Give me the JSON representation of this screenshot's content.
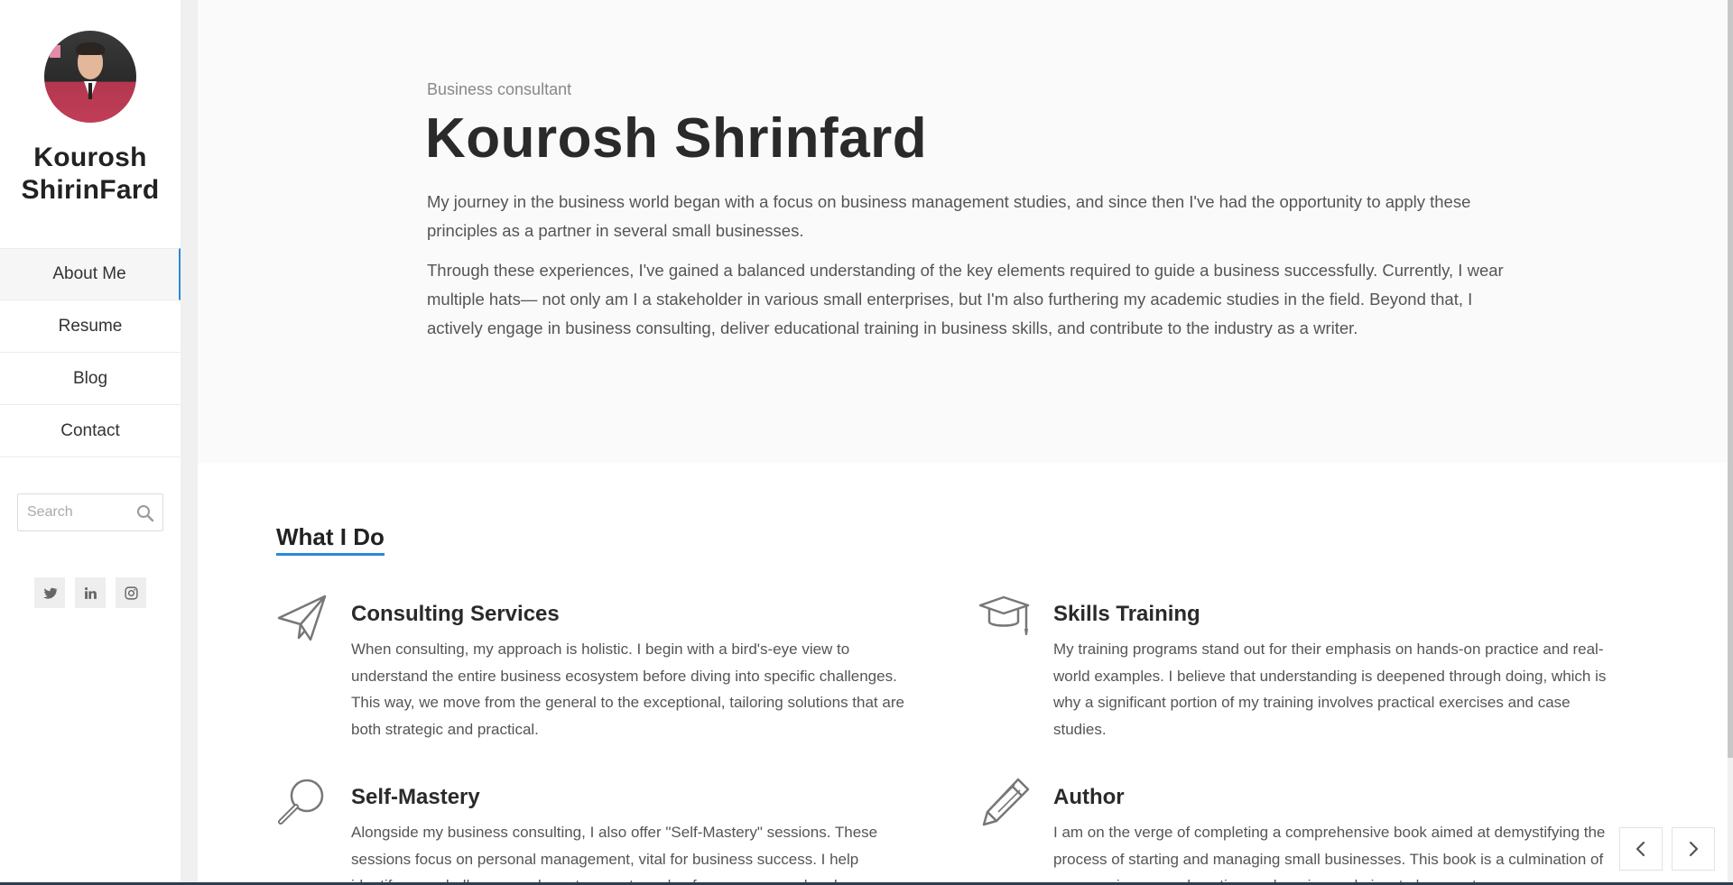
{
  "profile": {
    "name_line1": "Kourosh",
    "name_line2": "ShirinFard"
  },
  "nav": {
    "items": [
      {
        "label": "About Me",
        "active": true
      },
      {
        "label": "Resume"
      },
      {
        "label": "Blog"
      },
      {
        "label": "Contact"
      }
    ]
  },
  "search": {
    "placeholder": "Search"
  },
  "socials": [
    {
      "icon": "twitter-icon"
    },
    {
      "icon": "linkedin-icon"
    },
    {
      "icon": "instagram-icon"
    }
  ],
  "hero": {
    "subtitle": "Business consultant",
    "title": "Kourosh Shrinfard",
    "paragraph1": "My journey in the business world began with a focus on business management studies, and since then I've had the opportunity to apply these principles as a partner in several small businesses.",
    "paragraph2": "Through these experiences, I've gained a balanced understanding of the key elements required to guide a business successfully. Currently, I wear multiple hats— not only am I a stakeholder in various small enterprises, but I'm also furthering my academic studies in the field. Beyond that, I actively engage in business consulting, deliver educational training in business skills, and contribute to the industry as a writer."
  },
  "what_i_do": {
    "title": "What I Do",
    "services": [
      {
        "icon": "paper-plane-icon",
        "title": "Consulting Services",
        "text": "When consulting, my approach is holistic. I begin with a bird's-eye view to understand the entire business ecosystem before diving into specific challenges. This way, we move from the general to the exceptional, tailoring solutions that are both strategic and practical."
      },
      {
        "icon": "graduation-cap-icon",
        "title": "Skills Training",
        "text": "My training programs stand out for their emphasis on hands-on practice and real-world examples. I believe that understanding is deepened through doing, which is why a significant portion of my training involves practical exercises and case studies."
      },
      {
        "icon": "magnifier-icon",
        "title": "Self-Mastery",
        "text": "Alongside my business consulting, I also offer \"Self-Mastery\" sessions. These sessions focus on personal management, vital for business success. I help identify your challenges and create a custom plan for your personal and"
      },
      {
        "icon": "pencil-icon",
        "title": "Author",
        "text": "I am on the verge of completing a comprehensive book aimed at demystifying the process of starting and managing small businesses. This book is a culmination of my experiences and continuous learning and aims to be a go-to"
      }
    ]
  },
  "colors": {
    "accent": "#2b8ad8",
    "heading": "#2a2a2a",
    "text": "#555555"
  }
}
